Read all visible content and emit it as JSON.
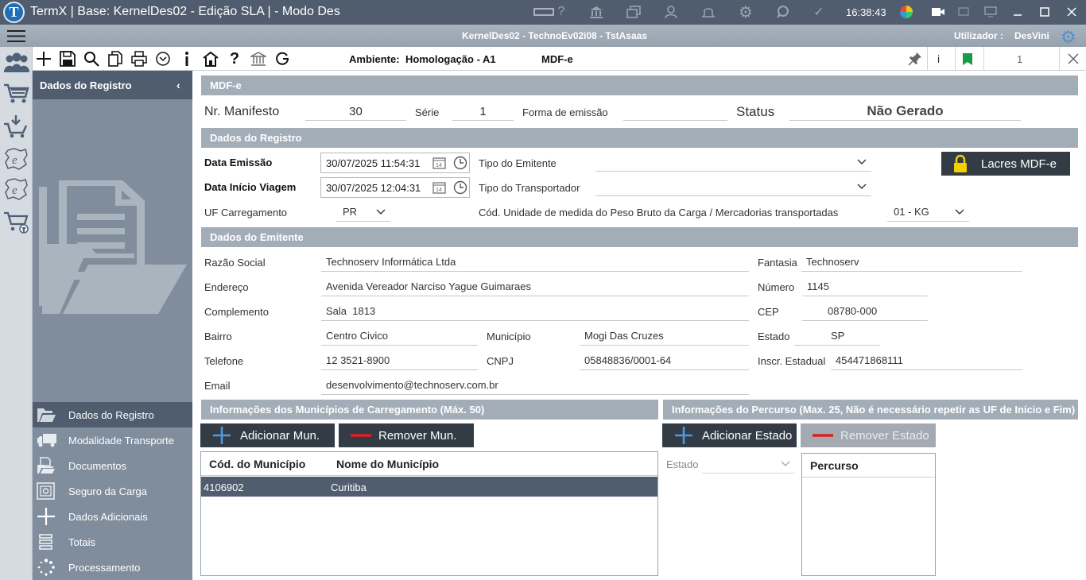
{
  "titlebar": {
    "title": "TermX | Base: KernelDes02 - Edição SLA | - Modo Des",
    "clock": "16:38:43"
  },
  "infobar": {
    "center": "KernelDes02 - TechnoEv02i08 - TstAsaas",
    "user_label": "Utilizador :",
    "user": "DesVini"
  },
  "toolbar": {
    "env_label": "Ambiente:",
    "env_value": "Homologação - A1",
    "doc_type": "MDF-e",
    "info": "i",
    "page": "1"
  },
  "sidebar": {
    "title": "Dados do Registro",
    "items": [
      {
        "label": "Dados do Registro",
        "icon": "open-folder-icon"
      },
      {
        "label": "Modalidade Transporte",
        "icon": "truck-icon"
      },
      {
        "label": "Documentos",
        "icon": "documents-icon"
      },
      {
        "label": "Seguro da Carga",
        "icon": "safe-icon"
      },
      {
        "label": "Dados Adicionais",
        "icon": "plus-icon"
      },
      {
        "label": "Totais",
        "icon": "totals-icon"
      },
      {
        "label": "Processamento",
        "icon": "spinner-icon"
      }
    ]
  },
  "mdfe": {
    "section": "MDF-e",
    "nr_label": "Nr. Manifesto",
    "nr": "30",
    "serie_label": "Série",
    "serie": "1",
    "forma_label": "Forma de emissão",
    "forma": "",
    "status_label": "Status",
    "status": "Não Gerado"
  },
  "registro": {
    "section": "Dados do Registro",
    "emissao_label": "Data Emissão",
    "emissao": "30/07/2025 11:54:31",
    "inicio_label": "Data Início Viagem",
    "inicio": "30/07/2025 12:04:31",
    "uf_label": "UF Carregamento",
    "uf": "PR",
    "tipo_emitente_label": "Tipo do Emitente",
    "tipo_emitente": "",
    "tipo_transp_label": "Tipo do Transportador",
    "tipo_transp": "",
    "unidade_label": "Cód. Unidade de medida do Peso Bruto da Carga / Mercadorias transportadas",
    "unidade": "01 - KG",
    "lacres_button": "Lacres MDF-e"
  },
  "emitente": {
    "section": "Dados do Emitente",
    "razao_label": "Razão Social",
    "razao": "Technoserv Informática Ltda",
    "fantasia_label": "Fantasia",
    "fantasia": "Technoserv",
    "endereco_label": "Endereço",
    "endereco": "Avenida Vereador Narciso Yague Guimaraes",
    "numero_label": "Número",
    "numero": "1145",
    "complemento_label": "Complemento",
    "complemento": "Sala  1813",
    "cep_label": "CEP",
    "cep": "08780-000",
    "bairro_label": "Bairro",
    "bairro": "Centro Civico",
    "municipio_label": "Município",
    "municipio": "Mogi Das Cruzes",
    "estado_label": "Estado",
    "estado": "SP",
    "telefone_label": "Telefone",
    "telefone": "12 3521-8900",
    "cnpj_label": "CNPJ",
    "cnpj": "05848836/0001-64",
    "ie_label": "Inscr. Estadual",
    "ie": "454471868111",
    "email_label": "Email",
    "email": "desenvolvimento@technoserv.com.br"
  },
  "municipios": {
    "section": "Informações dos Municípios de Carregamento (Máx. 50)",
    "add_button": "Adicionar Mun.",
    "remove_button": "Remover Mun.",
    "columns": [
      "Cód. do Município",
      "Nome do Município"
    ],
    "rows": [
      {
        "cod": "4106902",
        "nome": "Curitiba"
      }
    ]
  },
  "percurso": {
    "section": "Informações do Percurso (Max. 25, Não é necessário repetir as UF de Início e Fim)",
    "add_button": "Adicionar Estado",
    "remove_button": "Remover Estado",
    "estado_label": "Estado",
    "estado": "",
    "list_header": "Percurso"
  }
}
